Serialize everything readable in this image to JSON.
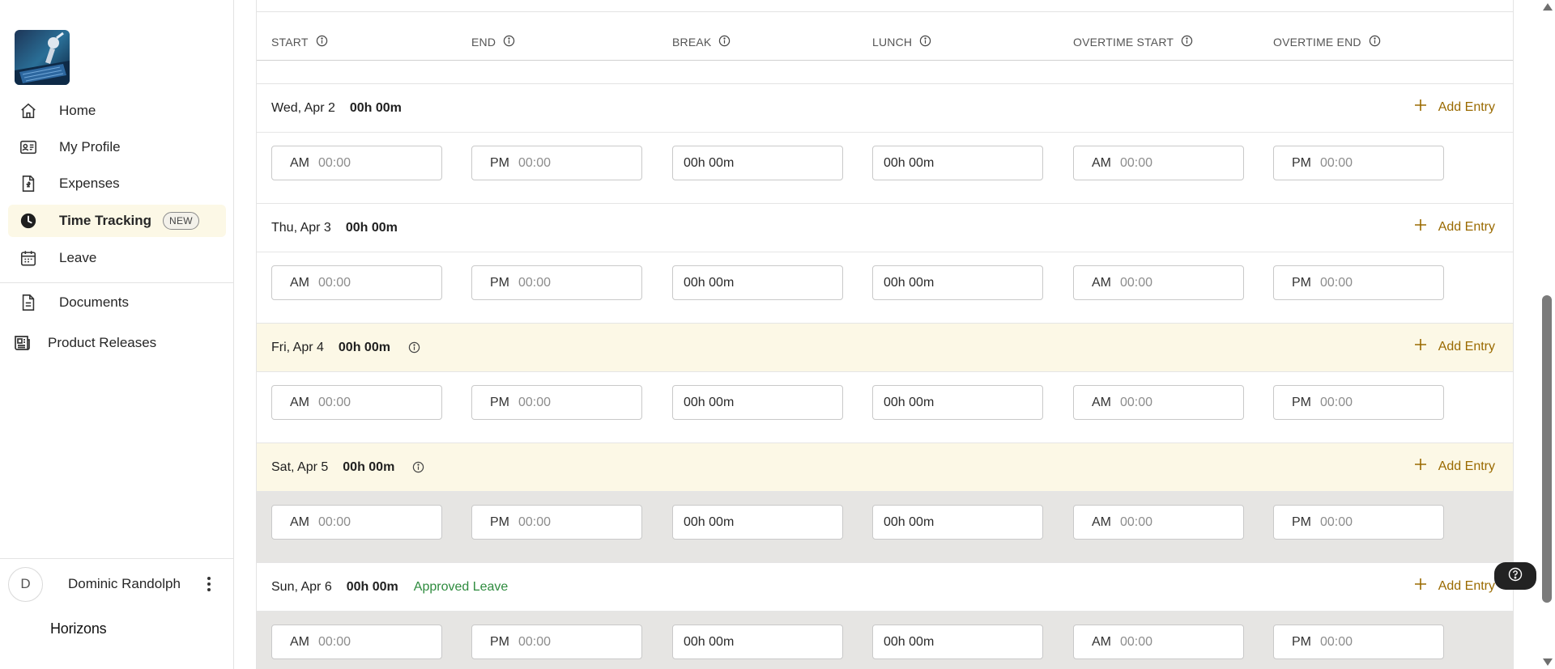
{
  "sidebar": {
    "nav": [
      {
        "label": "Home",
        "icon": "home-icon"
      },
      {
        "label": "My Profile",
        "icon": "id-card-icon"
      },
      {
        "label": "Expenses",
        "icon": "receipt-icon"
      },
      {
        "label": "Time Tracking",
        "icon": "clock-icon",
        "badge": "NEW",
        "active": true
      },
      {
        "label": "Leave",
        "icon": "calendar-icon"
      },
      {
        "label": "Documents",
        "icon": "document-icon"
      },
      {
        "label": "Product Releases",
        "icon": "newspaper-icon"
      }
    ],
    "user": {
      "initial": "D",
      "name": "Dominic Randolph"
    },
    "brand": "Horizons"
  },
  "columns": [
    "START",
    "END",
    "BREAK",
    "LUNCH",
    "OVERTIME START",
    "OVERTIME END"
  ],
  "add_entry_label": "Add Entry",
  "days": [
    {
      "label": "Wed, Apr 2",
      "total": "00h 00m",
      "entries": {
        "start_ampm": "AM",
        "start": "00:00",
        "end_ampm": "PM",
        "end": "00:00",
        "break": "00h 00m",
        "lunch": "00h 00m",
        "ot_start_ampm": "AM",
        "ot_start": "00:00",
        "ot_end_ampm": "PM",
        "ot_end": "00:00"
      }
    },
    {
      "label": "Thu, Apr 3",
      "total": "00h 00m",
      "entries": {
        "start_ampm": "AM",
        "start": "00:00",
        "end_ampm": "PM",
        "end": "00:00",
        "break": "00h 00m",
        "lunch": "00h 00m",
        "ot_start_ampm": "AM",
        "ot_start": "00:00",
        "ot_end_ampm": "PM",
        "ot_end": "00:00"
      }
    },
    {
      "label": "Fri, Apr 4",
      "total": "00h 00m",
      "entries": {
        "start_ampm": "AM",
        "start": "00:00",
        "end_ampm": "PM",
        "end": "00:00",
        "break": "00h 00m",
        "lunch": "00h 00m",
        "ot_start_ampm": "AM",
        "ot_start": "00:00",
        "ot_end_ampm": "PM",
        "ot_end": "00:00"
      }
    },
    {
      "label": "Sat, Apr 5",
      "total": "00h 00m",
      "entries": {
        "start_ampm": "AM",
        "start": "00:00",
        "end_ampm": "PM",
        "end": "00:00",
        "break": "00h 00m",
        "lunch": "00h 00m",
        "ot_start_ampm": "AM",
        "ot_start": "00:00",
        "ot_end_ampm": "PM",
        "ot_end": "00:00"
      }
    },
    {
      "label": "Sun, Apr 6",
      "total": "00h 00m",
      "status": "Approved Leave",
      "entries": {
        "start_ampm": "AM",
        "start": "00:00",
        "end_ampm": "PM",
        "end": "00:00",
        "break": "00h 00m",
        "lunch": "00h 00m",
        "ot_start_ampm": "AM",
        "ot_start": "00:00",
        "ot_end_ampm": "PM",
        "ot_end": "00:00"
      }
    }
  ],
  "colors": {
    "accent": "#9a6a00",
    "active_bg": "#fcf8e6",
    "leave_green": "#2e8b3e",
    "weekend_grey": "#e6e5e3"
  }
}
